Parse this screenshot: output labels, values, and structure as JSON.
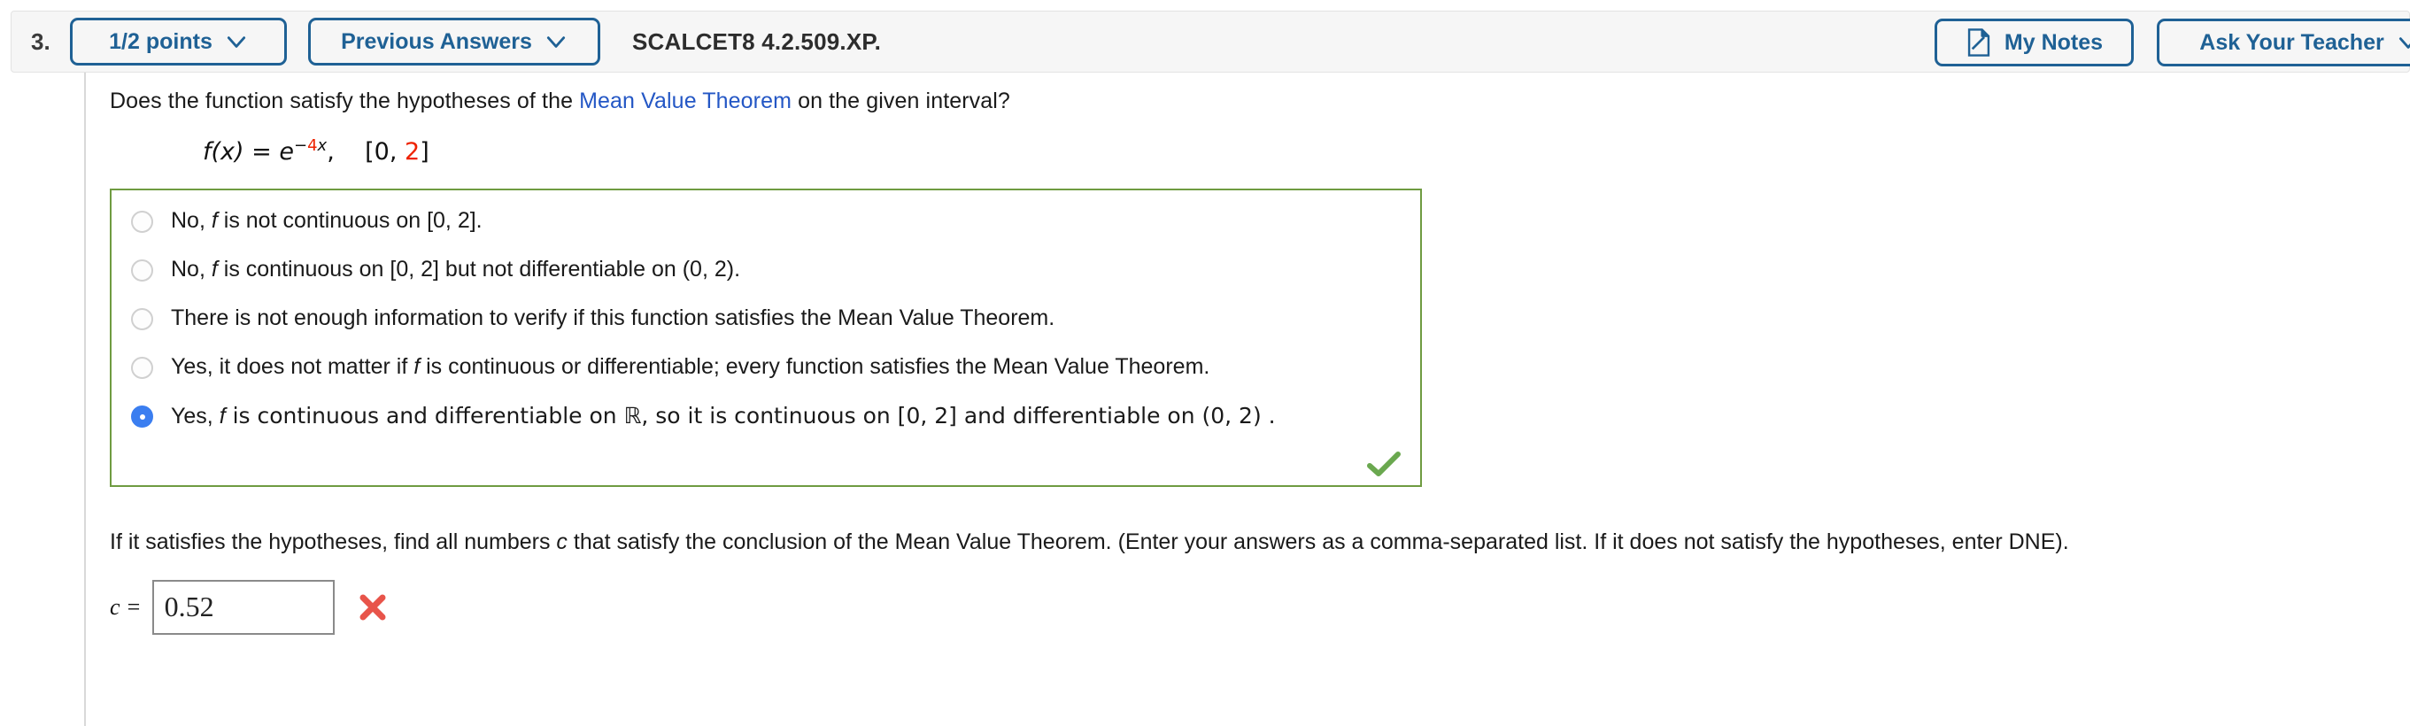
{
  "header": {
    "question_number": "3.",
    "points_label": "1/2 points",
    "previous_answers_label": "Previous Answers",
    "textbook_code": "SCALCET8 4.2.509.XP.",
    "my_notes_label": "My Notes",
    "ask_teacher_label": "Ask Your Teacher",
    "accent_color": "#1f6195",
    "bar_background": "#f6f6f6"
  },
  "question": {
    "prompt_before_link": "Does the function satisfy the hypotheses of the ",
    "link_text": "Mean Value Theorem",
    "prompt_after_link": " on the given interval?",
    "formula": {
      "function_name": "f",
      "variable": "(x)",
      "equals": " = ",
      "base": "e",
      "exponent_sign": "−",
      "exponent_coefficient": "4",
      "exponent_variable": "x",
      "comma": ",",
      "interval_open": "[0, ",
      "interval_end": "2",
      "interval_close": "]",
      "highlight_color": "#ee2200"
    }
  },
  "answer_box": {
    "border_color": "#6f9b41",
    "correct_mark": "check-mark",
    "options": [
      {
        "id": "option-1",
        "text_parts": [
          "No, ",
          "f",
          " is not continuous on [0, 2]."
        ],
        "selected": false
      },
      {
        "id": "option-2",
        "text_parts": [
          "No, ",
          "f",
          " is continuous on [0, 2] but not differentiable on (0, 2)."
        ],
        "selected": false
      },
      {
        "id": "option-3",
        "text_parts": [
          "There is not enough information to verify if this function satisfies the Mean Value Theorem.",
          "",
          ""
        ],
        "selected": false
      },
      {
        "id": "option-4",
        "text_parts": [
          "Yes, it does not matter if ",
          "f",
          " is continuous or differentiable; every function satisfies the Mean Value Theorem."
        ],
        "selected": false
      },
      {
        "id": "option-5",
        "text_parts": [
          "Yes, ",
          "f",
          " is continuous and differentiable on ℝ, so it is continuous on [0, 2] and differentiable on (0, 2) ."
        ],
        "selected": true
      }
    ]
  },
  "tail": {
    "part1": "If it satisfies the hypotheses, find all numbers ",
    "italic_c": "c",
    "part2": " that satisfy the conclusion of the Mean Value Theorem. (Enter your answers as a comma-separated list. If it does not satisfy the hypotheses, enter DNE).",
    "answer_label": "c =",
    "answer_value": "0.52",
    "answer_status": "incorrect",
    "incorrect_color": "#e8544a"
  }
}
